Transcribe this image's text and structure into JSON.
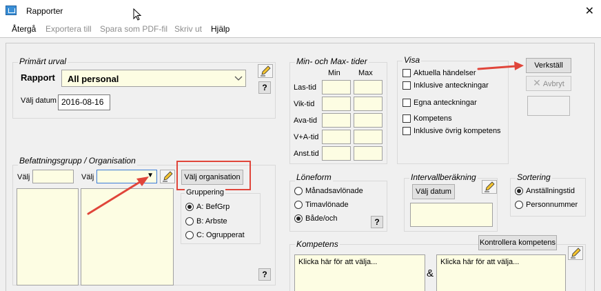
{
  "window": {
    "title": "Rapporter"
  },
  "menu": {
    "items": [
      {
        "label": "Återgå",
        "enabled": true
      },
      {
        "label": "Exportera till",
        "enabled": false
      },
      {
        "label": "Spara som PDF-fil",
        "enabled": false
      },
      {
        "label": "Skriv ut",
        "enabled": false
      },
      {
        "label": "Hjälp",
        "enabled": true
      }
    ]
  },
  "primart": {
    "title": "Primärt urval",
    "rapport_label": "Rapport",
    "rapport_value": "All personal",
    "datum_label": "Välj datum",
    "datum_value": "2016-08-16",
    "help": "?"
  },
  "befattning": {
    "title": "Befattningsgrupp / Organisation",
    "valj1_label": "Välj",
    "valj2_label": "Välj",
    "valj_org_button": "Välj organisation",
    "gruppering_title": "Gruppering",
    "gruppering_options": [
      "A: BefGrp",
      "B: Arbste",
      "C: Ogrupperat"
    ],
    "gruppering_selected": 0,
    "help": "?"
  },
  "minmax": {
    "title": "Min- och Max- tider",
    "col_min": "Min",
    "col_max": "Max",
    "rows": [
      "Las-tid",
      "Vik-tid",
      "Ava-tid",
      "V+A-tid",
      "Anst.tid"
    ]
  },
  "visa": {
    "title": "Visa",
    "options": [
      "Aktuella händelser",
      "Inklusive anteckningar",
      "Egna anteckningar",
      "Kompetens",
      "Inklusive övrig kompetens"
    ]
  },
  "actions": {
    "verkstall": "Verkställ",
    "avbryt": "Avbryt"
  },
  "loneform": {
    "title": "Löneform",
    "options": [
      "Månadsavlönade",
      "Timavlönade",
      "Både/och"
    ],
    "selected": 2,
    "help": "?"
  },
  "intervall": {
    "title": "Intervallberäkning",
    "button": "Välj datum"
  },
  "sortering": {
    "title": "Sortering",
    "options": [
      "Anställningstid",
      "Personnummer"
    ],
    "selected": 0
  },
  "kompetens": {
    "title": "Kompetens",
    "button": "Kontrollera kompetens",
    "field1_placeholder": "Klicka här för att välja...",
    "amp": "&",
    "field2_placeholder": "Klicka här för att välja..."
  },
  "colors": {
    "field_bg": "#fdfde3",
    "annotation": "#e0453a"
  }
}
